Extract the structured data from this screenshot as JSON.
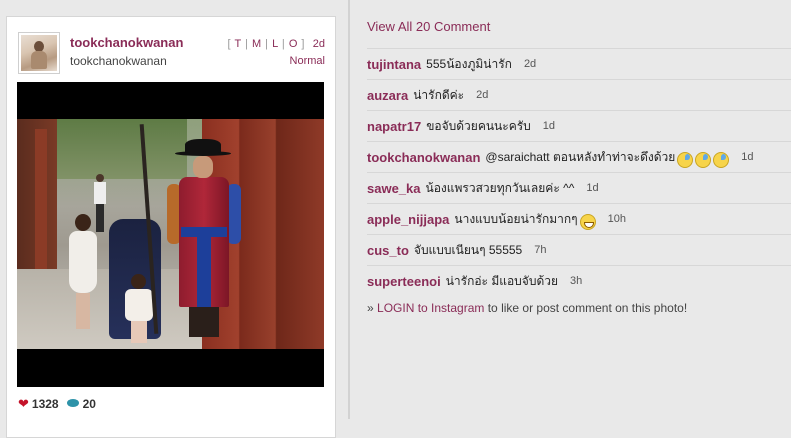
{
  "post": {
    "username": "tookchanokwanan",
    "full_name": "tookchanokwanan",
    "tmlo": [
      "T",
      "M",
      "L",
      "O"
    ],
    "age": "2d",
    "filter": "Normal",
    "likes": "1328",
    "comments_count": "20"
  },
  "comments_panel": {
    "view_all_label": "View All 20 Comment",
    "comments": [
      {
        "user": "tujintana",
        "text": "555น้องภูมิน่ารัก",
        "time": "2d",
        "emoji": []
      },
      {
        "user": "auzara",
        "text": "น่ารักดีค่ะ",
        "time": "2d",
        "emoji": []
      },
      {
        "user": "napatr17",
        "text": "ขอจับด้วยคนนะครับ",
        "time": "1d",
        "emoji": []
      },
      {
        "user": "tookchanokwanan",
        "text": "@saraichatt ตอนหลังทำท่าจะดึงด้วย",
        "time": "1d",
        "emoji": [
          "sad",
          "sad",
          "sad"
        ]
      },
      {
        "user": "sawe_ka",
        "text": "น้องแพรวสวยทุกวันเลยค่ะ ^^",
        "time": "1d",
        "emoji": []
      },
      {
        "user": "apple_nijjapa",
        "text": "นางแบบน้อยน่ารักมากๆ",
        "time": "10h",
        "emoji": [
          "grin"
        ]
      },
      {
        "user": "cus_to",
        "text": "จับแบบเนียนๆ 55555",
        "time": "7h",
        "emoji": []
      },
      {
        "user": "superteenoi",
        "text": "น่ารักอ่ะ มีแอบจับด้วย",
        "time": "3h",
        "emoji": []
      }
    ],
    "login_prefix": "» ",
    "login_link": "LOGIN to Instagram",
    "login_suffix": " to like or post comment on this photo!"
  },
  "icons": {
    "like": "heart-icon",
    "comment": "speech-bubble-icon"
  },
  "colors": {
    "accent": "#8a2c57",
    "heart": "#c4132a",
    "comment_icon": "#2e93a9"
  }
}
